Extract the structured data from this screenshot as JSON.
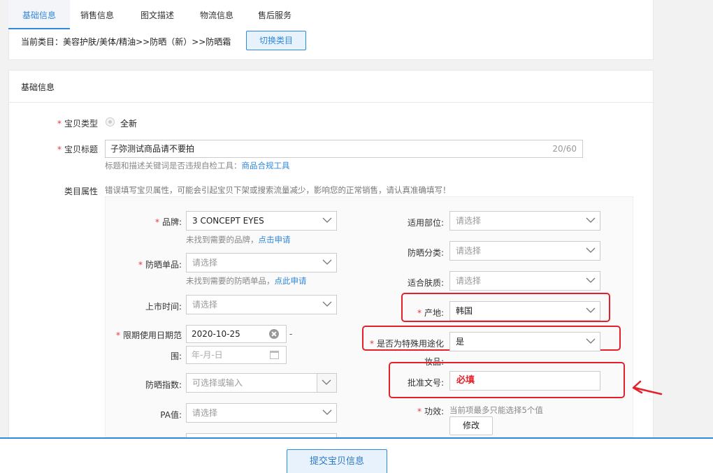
{
  "tabs": [
    {
      "label": "基础信息",
      "active": true
    },
    {
      "label": "销售信息",
      "active": false
    },
    {
      "label": "图文描述",
      "active": false
    },
    {
      "label": "物流信息",
      "active": false
    },
    {
      "label": "售后服务",
      "active": false
    }
  ],
  "category": {
    "text": "当前类目：美容护肤/美体/精油>>防晒（新）>>防晒霜",
    "switch_label": "切换类目"
  },
  "section_title": "基础信息",
  "item_type": {
    "label": "宝贝类型",
    "option": "全新"
  },
  "item_title": {
    "label": "宝贝标题",
    "value": "子弥测试商品请不要拍",
    "counter": "20/60",
    "hint": "标题和描述关键词是否违规自检工具：",
    "hint_link": "商品合规工具"
  },
  "attributes": {
    "label": "类目属性",
    "warning": "错误填写宝贝属性，可能会引起宝贝下架或搜索流量减少，影响您的正常销售，请认真准确填写！"
  },
  "left_fields": {
    "brand": {
      "label": "品牌:",
      "value": "3 CONCEPT EYES",
      "hint": "未找到需要的品牌，",
      "hint_link": "点击申请"
    },
    "sunscreen_item": {
      "label": "防晒单品:",
      "placeholder": "请选择",
      "hint": "未找到需要的防晒单品，",
      "hint_link": "点此申请"
    },
    "launch_time": {
      "label": "上市时间:",
      "placeholder": "请选择"
    },
    "expiry": {
      "label_1": "限期使用日期范",
      "label_2": "围:",
      "start": "2020-10-25",
      "separator": "-",
      "end_placeholder": "年-月-日"
    },
    "spf": {
      "label": "防晒指数:",
      "placeholder": "可选择或输入"
    },
    "pa": {
      "label": "PA值:",
      "placeholder": "请选择"
    }
  },
  "right_fields": {
    "body_part": {
      "label": "适用部位:",
      "placeholder": "请选择"
    },
    "sunscreen_category": {
      "label": "防晒分类:",
      "placeholder": "请选择"
    },
    "skin_type": {
      "label": "适合肤质:",
      "placeholder": "请选择"
    },
    "origin": {
      "label": "产地:",
      "value": "韩国"
    },
    "special_use": {
      "label_1": "是否为特殊用途化",
      "label_2": "妆品:",
      "value": "是"
    },
    "approval": {
      "label": "批准文号:",
      "value": "必填"
    },
    "efficacy": {
      "label": "功效:",
      "hint": "当前项最多只能选择5个值",
      "button": "修改"
    }
  },
  "submit_label": "提交宝贝信息",
  "colors": {
    "accent": "#3089dc",
    "required": "#e4393c",
    "annotation": "#e4202b"
  }
}
